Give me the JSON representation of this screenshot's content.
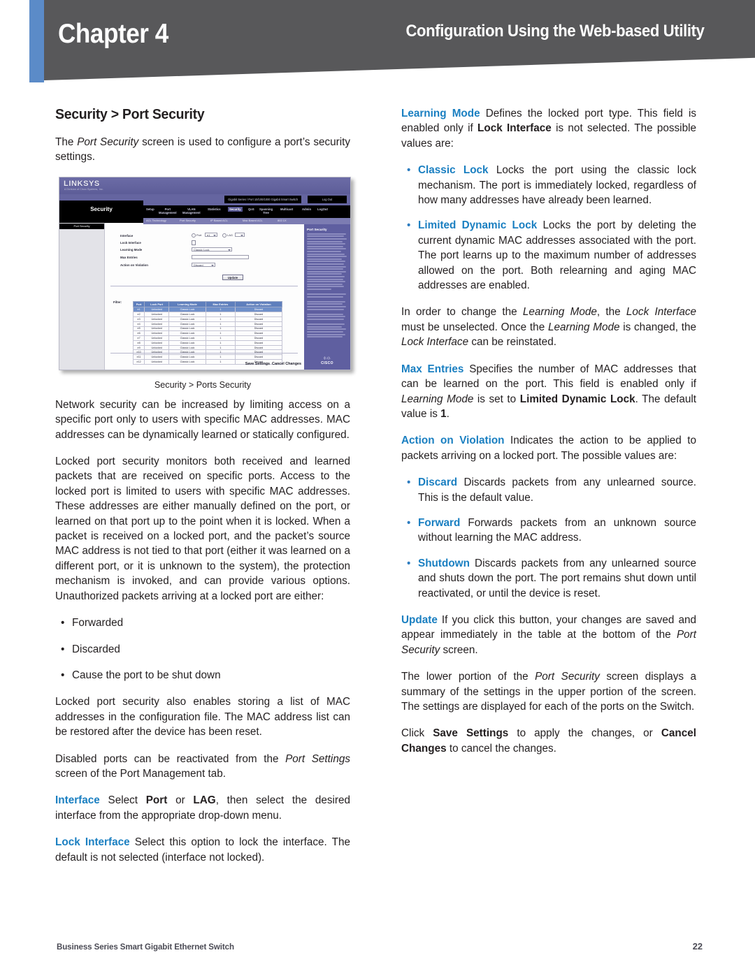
{
  "header": {
    "chapter": "Chapter 4",
    "section": "Configuration Using the Web-based Utility",
    "blue_stripe_color": "#5b8bc8",
    "banner_color": "#58585a"
  },
  "accent_color": "#1a7fc1",
  "left_column": {
    "heading": "Security > Port Security",
    "intro": "The Port Security screen is used to configure a port’s security settings.",
    "figure_caption": "Security > Ports Security",
    "para_network": "Network security can be increased by limiting access on a specific port only to users with specific MAC addresses. MAC addresses can be dynamically learned or statically configured.",
    "para_locked": "Locked port security monitors both received and learned packets that are received on specific ports. Access to the locked port is limited to users with specific MAC addresses. These addresses are either manually defined on the port, or learned on that port up to the point when it is locked. When a packet is received on a locked port, and the packet’s source MAC address is not tied to that port (either it was learned on a different port, or it is unknown to the system), the protection mechanism is invoked, and can provide various options. Unauthorized packets arriving at a locked port are either:",
    "bullets": [
      "Forwarded",
      "Discarded",
      "Cause the port to be shut down"
    ],
    "para_storing": "Locked port security also enables storing a list of MAC addresses in the configuration file. The MAC address list can be restored after the device has been reset.",
    "para_disabled": "Disabled ports can be reactivated from the Port Settings screen of the Port Management tab.",
    "interface_term": "Interface",
    "interface_text_1": " Select ",
    "interface_bold_1": "Port",
    "interface_text_2": " or ",
    "interface_bold_2": "LAG",
    "interface_text_3": ", then select the desired interface from the appropriate drop-down menu.",
    "lock_term": "Lock Interface",
    "lock_text": " Select this option to lock the interface. The default is not selected (interface not locked)."
  },
  "right_column": {
    "learning_term": "Learning Mode",
    "learning_text_1": " Defines the locked port type. This field is enabled only if ",
    "learning_bold": "Lock Interface",
    "learning_text_2": " is not selected. The possible values are:",
    "learning_bullets": [
      {
        "term": "Classic Lock",
        "text": " Locks the port using the classic lock mechanism. The port is immediately locked, regardless of how many addresses have already been learned."
      },
      {
        "term": "Limited Dynamic Lock",
        "text": " Locks the port by deleting the current dynamic MAC addresses associated with the port. The port learns up to the maximum number of addresses allowed on the port. Both relearning and aging MAC addresses are enabled."
      }
    ],
    "para_order": "In order to change the Learning Mode, the Lock Interface must be unselected. Once the Learning Mode is changed, the Lock Interface can be reinstated.",
    "max_term": "Max Entries",
    "max_text_1": " Specifies the number of MAC addresses that can be learned on the port. This field is enabled only if ",
    "max_ital": "Learning Mode",
    "max_text_2": " is set to ",
    "max_bold": "Limited Dynamic Lock",
    "max_text_3": ". The default value is ",
    "max_bold2": "1",
    "max_text_4": ".",
    "action_term": "Action on Violation",
    "action_text": " Indicates the action to be applied to packets arriving on a locked port. The possible values are:",
    "action_bullets": [
      {
        "term": "Discard",
        "text": " Discards packets from any unlearned source. This is the default value."
      },
      {
        "term": "Forward",
        "text": " Forwards packets from an unknown source without learning the MAC address."
      },
      {
        "term": "Shutdown",
        "text": " Discards packets from any unlearned source and shuts down the port. The port remains shut down until reactivated, or until the device is reset."
      }
    ],
    "update_term": "Update",
    "update_text_1": " If you click this button, your changes are saved and appear immediately in the table at the bottom of the ",
    "update_ital": "Port Security",
    "update_text_2": " screen.",
    "para_lower": "The lower portion of the Port Security screen displays a summary of the settings in the upper portion of the screen.  The settings are displayed for each of the ports on the Switch.",
    "click_text_1": "Click ",
    "click_bold_1": "Save Settings",
    "click_text_2": " to apply the changes, or ",
    "click_bold_2": "Cancel Changes",
    "click_text_3": " to cancel the changes."
  },
  "ui_screenshot": {
    "brand": "LINKSYS",
    "brand_sub": "A Division of Cisco Systems, Inc.",
    "device_title": "Gigabit Series / Port 10/100/1000 Gigabit Smart Switch",
    "logout_label": "Log Out",
    "module_label": "Security",
    "nav_items": [
      "Setup",
      "Port\nManagement",
      "VLAN\nManagement",
      "Statistics",
      "Security",
      "QoS",
      "Spanning\nTree",
      "Multicast",
      "Admin",
      "LogOut"
    ],
    "active_nav": "Security",
    "subnav_items": [
      "ACL Technology",
      "Port Security",
      "IP Based ACL",
      "Mac Based ACL",
      "802.1X"
    ],
    "sidebar_item": "Port Security",
    "form_labels": [
      "Interface",
      "Lock Interface",
      "Learning Mode",
      "Max Entries",
      "Action on Violation"
    ],
    "radio_port": "Port",
    "radio_lag": "LAG",
    "port_value": "e1",
    "learning_mode_value": "Classic Lock",
    "max_entries_value": "",
    "action_value": "Discard",
    "update_button": "Update",
    "filter_label": "Filter:",
    "filter_go": "Filter",
    "table_headers": [
      "Port",
      "Lock Port",
      "Learning Mode",
      "Max Entries",
      "Action on Violation"
    ],
    "table_rows": [
      [
        "e1",
        "Unlocked",
        "Classic Lock",
        "1",
        "Discard"
      ],
      [
        "e2",
        "Unlocked",
        "Classic Lock",
        "1",
        "Discard"
      ],
      [
        "e3",
        "Unlocked",
        "Classic Lock",
        "1",
        "Discard"
      ],
      [
        "e4",
        "Unlocked",
        "Classic Lock",
        "1",
        "Discard"
      ],
      [
        "e5",
        "Unlocked",
        "Classic Lock",
        "1",
        "Discard"
      ],
      [
        "e6",
        "Unlocked",
        "Classic Lock",
        "1",
        "Discard"
      ],
      [
        "e7",
        "Unlocked",
        "Classic Lock",
        "1",
        "Discard"
      ],
      [
        "e8",
        "Unlocked",
        "Classic Lock",
        "1",
        "Discard"
      ],
      [
        "e9",
        "Unlocked",
        "Classic Lock",
        "1",
        "Discard"
      ],
      [
        "e10",
        "Unlocked",
        "Classic Lock",
        "1",
        "Discard"
      ],
      [
        "e11",
        "Unlocked",
        "Classic Lock",
        "1",
        "Discard"
      ],
      [
        "e12",
        "Unlocked",
        "Classic Lock",
        "1",
        "Discard"
      ]
    ],
    "selected_row_index": 0,
    "help_title": "Port Security",
    "save_settings": "Save Settings",
    "cancel_changes": "Cancel Changes",
    "vendor_logo": "CISCO"
  },
  "footer": {
    "left": "Business Series Smart Gigabit Ethernet Switch",
    "page": "22"
  }
}
